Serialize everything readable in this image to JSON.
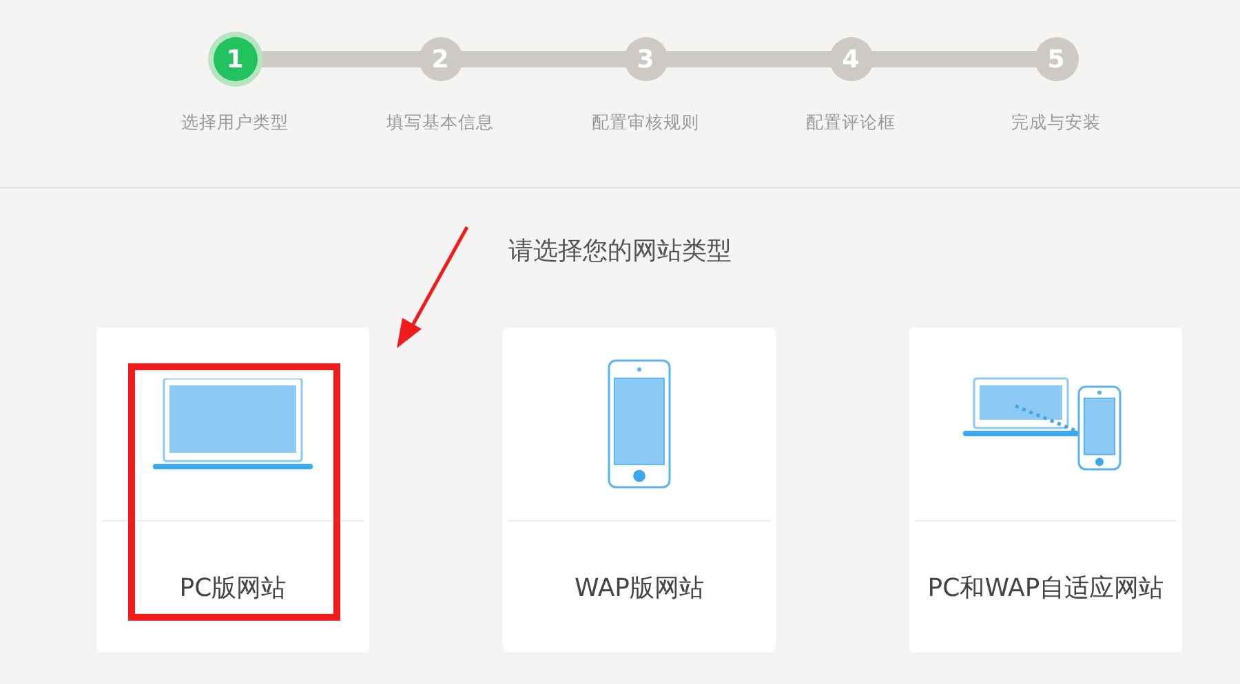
{
  "steps": [
    {
      "number": "1",
      "label": "选择用户类型",
      "selected": true
    },
    {
      "number": "2",
      "label": "填写基本信息",
      "selected": false
    },
    {
      "number": "3",
      "label": "配置审核规则",
      "selected": false
    },
    {
      "number": "4",
      "label": "配置评论框",
      "selected": false
    },
    {
      "number": "5",
      "label": "完成与安装",
      "selected": false
    }
  ],
  "heading": "请选择您的网站类型",
  "cards": [
    {
      "kind": "pc",
      "label": "PC版网站",
      "highlighted": true
    },
    {
      "kind": "wap",
      "label": "WAP版网站",
      "highlighted": false
    },
    {
      "kind": "both",
      "label": "PC和WAP自适应网站",
      "highlighted": false
    }
  ]
}
